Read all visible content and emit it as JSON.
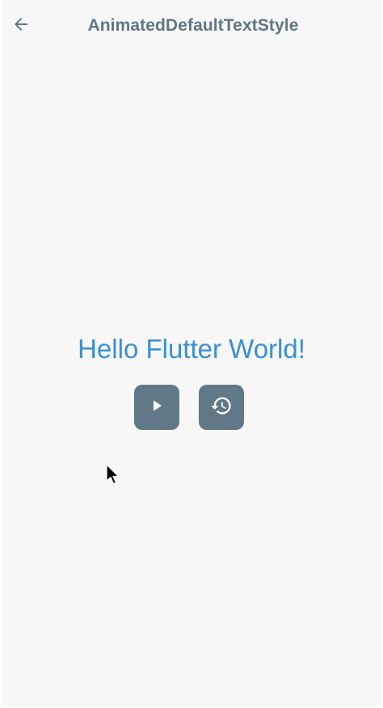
{
  "app_bar": {
    "title": "AnimatedDefaultTextStyle",
    "back_icon": "arrow-back-icon"
  },
  "main": {
    "headline": "Hello Flutter World!",
    "buttons": [
      {
        "icon": "play-icon"
      },
      {
        "icon": "restore-history-icon"
      }
    ]
  },
  "colors": {
    "background": "#f7f7f7",
    "title": "#5f7683",
    "headline": "#3a8fd5",
    "button": "#617987"
  }
}
